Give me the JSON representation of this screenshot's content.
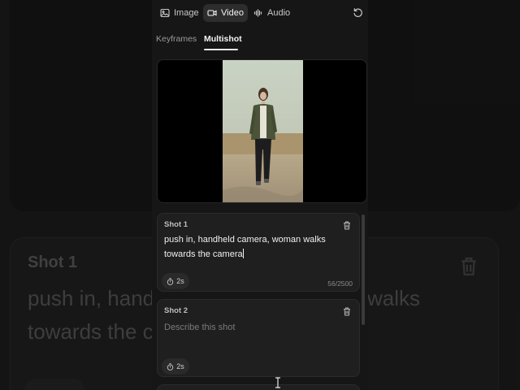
{
  "modes": [
    {
      "label": "Image",
      "icon": "image-icon",
      "active": false
    },
    {
      "label": "Video",
      "icon": "video-icon",
      "active": true
    },
    {
      "label": "Audio",
      "icon": "audio-icon",
      "active": false
    }
  ],
  "tabs": [
    {
      "label": "Keyframes",
      "active": false
    },
    {
      "label": "Multishot",
      "active": true
    }
  ],
  "shots": [
    {
      "title": "Shot 1",
      "text": "push in, handheld camera, woman walks towards the camera",
      "placeholder": "",
      "duration": "2s",
      "char_count": "56/2500"
    },
    {
      "title": "Shot 2",
      "text": "",
      "placeholder": "Describe this shot",
      "duration": "2s",
      "char_count": ""
    }
  ],
  "background": {
    "shot_title": "Shot 1",
    "line1": "push in, hand",
    "line1_end": "walks",
    "line2": "towards the c"
  },
  "colors": {
    "panel": "#161616",
    "card": "#1f1f1f",
    "active_mode": "#2d2d2d",
    "text": "#f0f0f0",
    "muted": "#7b7b7b"
  }
}
